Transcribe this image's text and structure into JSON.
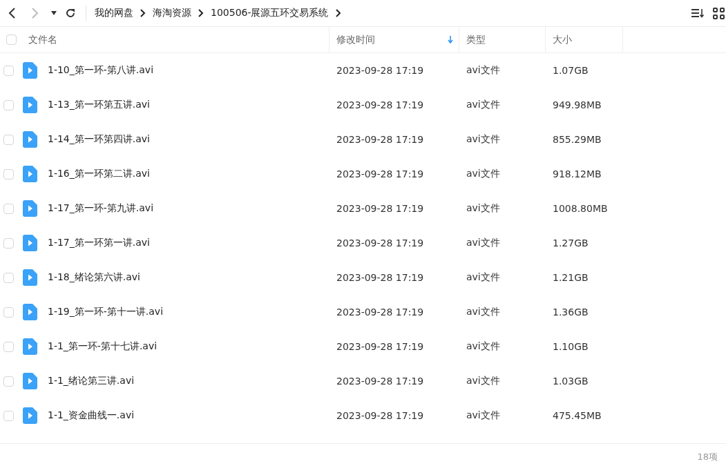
{
  "breadcrumb": [
    "我的网盘",
    "海淘资源",
    "100506-展源五环交易系统"
  ],
  "table": {
    "select_all": {
      "checked": false
    },
    "columns": [
      {
        "label": "文件名",
        "sorted": false
      },
      {
        "label": "修改时间",
        "sorted": true
      },
      {
        "label": "类型",
        "sorted": false
      },
      {
        "label": "大小",
        "sorted": false
      }
    ],
    "rows": [
      {
        "name": "1-10_第一环-第八讲.avi",
        "modified": "2023-09-28 17:19",
        "type": "avi文件",
        "size": "1.07GB",
        "checked": false
      },
      {
        "name": "1-13_第一环第五讲.avi",
        "modified": "2023-09-28 17:19",
        "type": "avi文件",
        "size": "949.98MB",
        "checked": false
      },
      {
        "name": "1-14_第一环第四讲.avi",
        "modified": "2023-09-28 17:19",
        "type": "avi文件",
        "size": "855.29MB",
        "checked": false
      },
      {
        "name": "1-16_第一环第二讲.avi",
        "modified": "2023-09-28 17:19",
        "type": "avi文件",
        "size": "918.12MB",
        "checked": false
      },
      {
        "name": "1-17_第一环-第九讲.avi",
        "modified": "2023-09-28 17:19",
        "type": "avi文件",
        "size": "1008.80MB",
        "checked": false
      },
      {
        "name": "1-17_第一环第一讲.avi",
        "modified": "2023-09-28 17:19",
        "type": "avi文件",
        "size": "1.27GB",
        "checked": false
      },
      {
        "name": "1-18_绪论第六讲.avi",
        "modified": "2023-09-28 17:19",
        "type": "avi文件",
        "size": "1.21GB",
        "checked": false
      },
      {
        "name": "1-19_第一环-第十一讲.avi",
        "modified": "2023-09-28 17:19",
        "type": "avi文件",
        "size": "1.36GB",
        "checked": false
      },
      {
        "name": "1-1_第一环-第十七讲.avi",
        "modified": "2023-09-28 17:19",
        "type": "avi文件",
        "size": "1.10GB",
        "checked": false
      },
      {
        "name": "1-1_绪论第三讲.avi",
        "modified": "2023-09-28 17:19",
        "type": "avi文件",
        "size": "1.03GB",
        "checked": false
      },
      {
        "name": "1-1_资金曲线一.avi",
        "modified": "2023-09-28 17:19",
        "type": "avi文件",
        "size": "475.45MB",
        "checked": false
      }
    ]
  },
  "status_bar": {
    "count": "18项"
  }
}
